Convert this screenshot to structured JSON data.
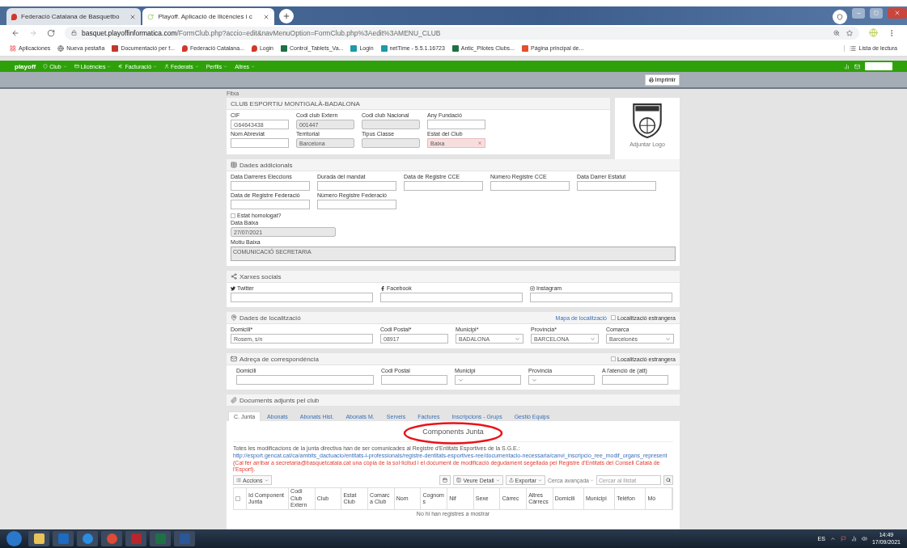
{
  "browser": {
    "tabs": [
      {
        "title": "Federació Catalana de Basquetbo",
        "selected": false
      },
      {
        "title": "Playoff. Aplicació de llicències i c",
        "selected": true
      }
    ],
    "url_host": "basquet.playoffinformatica.com",
    "url_path": "/FormClub.php?accio=edit&navMenuOption=FormClub.php%3Aedit%3AMENU_CLUB",
    "bookmarks": [
      {
        "label": "Aplicaciones",
        "kind": "apps"
      },
      {
        "label": "Nueva pestaña",
        "kind": "globe"
      },
      {
        "label": "Documentació per f...",
        "kind": "doc"
      },
      {
        "label": "Federació Catalana...",
        "kind": "pin"
      },
      {
        "label": "Login",
        "kind": "pin"
      },
      {
        "label": "Control_Tablets_Va...",
        "kind": "excel"
      },
      {
        "label": "Login",
        "kind": "teal"
      },
      {
        "label": "netTime - 5.5.1.16723",
        "kind": "teal"
      },
      {
        "label": "Antic_Pilotes Clubs...",
        "kind": "excel"
      },
      {
        "label": "Página principal de...",
        "kind": "office"
      }
    ],
    "reading_list": "Lista de lectura"
  },
  "navbar": {
    "brand": "playoff",
    "items": [
      {
        "label": "Club",
        "kind": "shield"
      },
      {
        "label": "Llicències",
        "kind": "card"
      },
      {
        "label": "Facturació",
        "kind": "euro"
      },
      {
        "label": "Federats",
        "kind": "user"
      },
      {
        "label": "Perfils",
        "kind": "none"
      },
      {
        "label": "Altres",
        "kind": "none"
      }
    ]
  },
  "print_button": "Imprimir",
  "breadcrumb": "Fitxa",
  "club": {
    "name": "CLUB ESPORTIU MONTIGALÀ-BADALONA",
    "logo_link": "Adjuntar Logo",
    "fields": [
      {
        "label": "CIF",
        "value": "G64643438",
        "kind": "text"
      },
      {
        "label": "Codi club Extern",
        "value": "001447",
        "kind": "readonly"
      },
      {
        "label": "Codi club Nacional",
        "kind": "readonly"
      },
      {
        "label": "Any Fundació",
        "kind": "text"
      },
      {
        "label": "Nom Abreviat",
        "kind": "text"
      },
      {
        "label": "Territorial",
        "value": "Barcelona",
        "kind": "readonly"
      },
      {
        "label": "Tipus Classe",
        "kind": "readonly"
      },
      {
        "label": "Estat del Club",
        "value": "Baixa",
        "kind": "status"
      }
    ]
  },
  "additional": {
    "title": "Dades addicionals",
    "fields": [
      {
        "label": "Data Darreres Eleccions",
        "kind": "text"
      },
      {
        "label": "Durada del mandat",
        "kind": "text"
      },
      {
        "label": "Data de Registre CCE",
        "kind": "text"
      },
      {
        "label": "Número Registre CCE",
        "kind": "text"
      },
      {
        "label": "Data Darrer Estatut",
        "kind": "text"
      },
      {
        "label": "Data de Registre Federació",
        "kind": "text"
      },
      {
        "label": "Número Registre Federació",
        "kind": "text"
      }
    ],
    "homologated": {
      "label": "Estat homologat?",
      "checked": false
    },
    "leave_date": {
      "label": "Data Baixa",
      "value": "27/07/2021"
    },
    "leave_reason": {
      "label": "Motiu Baixa",
      "value": "COMUNICACIÓ SECRETARIA"
    }
  },
  "social": {
    "title": "Xarxes socials",
    "fields": [
      {
        "label": "Twitter",
        "kind": "twitter"
      },
      {
        "label": "Facebook",
        "kind": "facebook"
      },
      {
        "label": "Instagram",
        "kind": "instagram"
      }
    ]
  },
  "location": {
    "title": "Dades de localització",
    "map_link": "Mapa de localització",
    "foreign": {
      "label": "Localització estrangera",
      "checked": false
    },
    "fields": [
      {
        "label": "Domicili*",
        "value": "Rosem, s/n",
        "kind": "text"
      },
      {
        "label": "Codi Postal*",
        "value": "08917",
        "kind": "text"
      },
      {
        "label": "Municipi*",
        "value": "BADALONA",
        "kind": "select"
      },
      {
        "label": "Província*",
        "value": "BARCELONA",
        "kind": "select"
      },
      {
        "label": "Comarca",
        "value": "Barcelonès",
        "kind": "select"
      }
    ]
  },
  "correspondence": {
    "title": "Adreça de correspondència",
    "foreign": {
      "label": "Localització estrangera",
      "checked": false
    },
    "fields": [
      {
        "label": "Domicili",
        "kind": "text"
      },
      {
        "label": "Codi Postal",
        "kind": "text"
      },
      {
        "label": "Municipi",
        "kind": "select"
      },
      {
        "label": "Província",
        "kind": "select"
      },
      {
        "label": "A l'atenció de (att)",
        "kind": "text"
      }
    ]
  },
  "documents": {
    "title": "Documents adjunts pel club"
  },
  "tabs": [
    {
      "label": "C. Junta",
      "selected": true
    },
    {
      "label": "Abonats",
      "selected": false
    },
    {
      "label": "Abonats Hist.",
      "selected": false
    },
    {
      "label": "Abonats M.",
      "selected": false
    },
    {
      "label": "Serveis",
      "selected": false
    },
    {
      "label": "Factures",
      "selected": false
    },
    {
      "label": "Inscripcions - Grups",
      "selected": false
    },
    {
      "label": "Gestió Equips",
      "selected": false
    }
  ],
  "junta": {
    "title": "Components Junta",
    "notice": "Totes les modificacions de la junta directiva han de ser comunicades al Registre d'Entitats Esportives de la S.G.E.:",
    "link": "http://esport.gencat.cat/ca/ambits_dactuacio/entitats-i-professionals/registre-dentitats-esportives-ree/documentacio-necessaria/canvi_inscripcio_ree_modif_organs_represent",
    "warning": "(Cal fer arribar a secretaria@basquetcatala.cat una còpia de la sol·licitud i el document de modificació degudament segellada pel Registre d'Entitats del Consell Català de l'Esport).",
    "actions": "Accions",
    "view": "Veure Detall",
    "export": "Exportar",
    "advanced": "Cerca avançada",
    "search_placeholder": "Cercar al llistat",
    "columns": [
      "Id Component Junta",
      "Codi Club Extern",
      "Club",
      "Estat Club",
      "Comarca Club",
      "Nom",
      "Cognoms",
      "Nif",
      "Sexe",
      "Càrrec",
      "Altres Càrrecs",
      "Domicili",
      "Municipi",
      "Telèfon",
      "Mò"
    ],
    "select_all_checked": false,
    "empty": "No hi han registres a mostrar"
  },
  "taskbar": {
    "language": "ES",
    "time": "14:49",
    "date": "17/09/2021"
  }
}
